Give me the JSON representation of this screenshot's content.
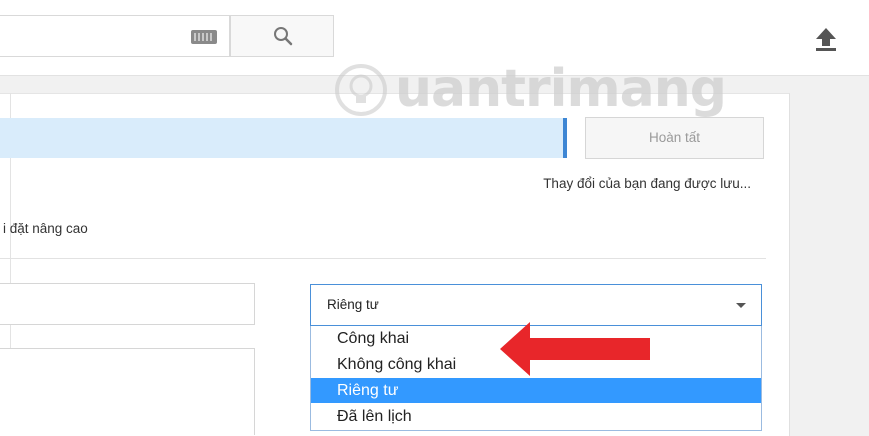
{
  "header": {
    "search_placeholder": "",
    "keyboard_icon": "keyboard-icon",
    "search_icon": "search-icon",
    "upload_icon": "upload-icon"
  },
  "watermark": {
    "text": "uantrimang"
  },
  "editor": {
    "done_label": "Hoàn tất",
    "save_status": "Thay đổi của bạn đang được lưu...",
    "advanced_tab_label": "i đặt nâng cao",
    "title_value": "",
    "description_value": ""
  },
  "privacy": {
    "selected": "Riêng tư",
    "options": [
      "Công khai",
      "Không công khai",
      "Riêng tư",
      "Đã lên lịch"
    ],
    "highlighted_index": 2
  },
  "colors": {
    "accent": "#3399ff",
    "progress": "#d9ecfb",
    "annotation_arrow": "#e8262a"
  }
}
